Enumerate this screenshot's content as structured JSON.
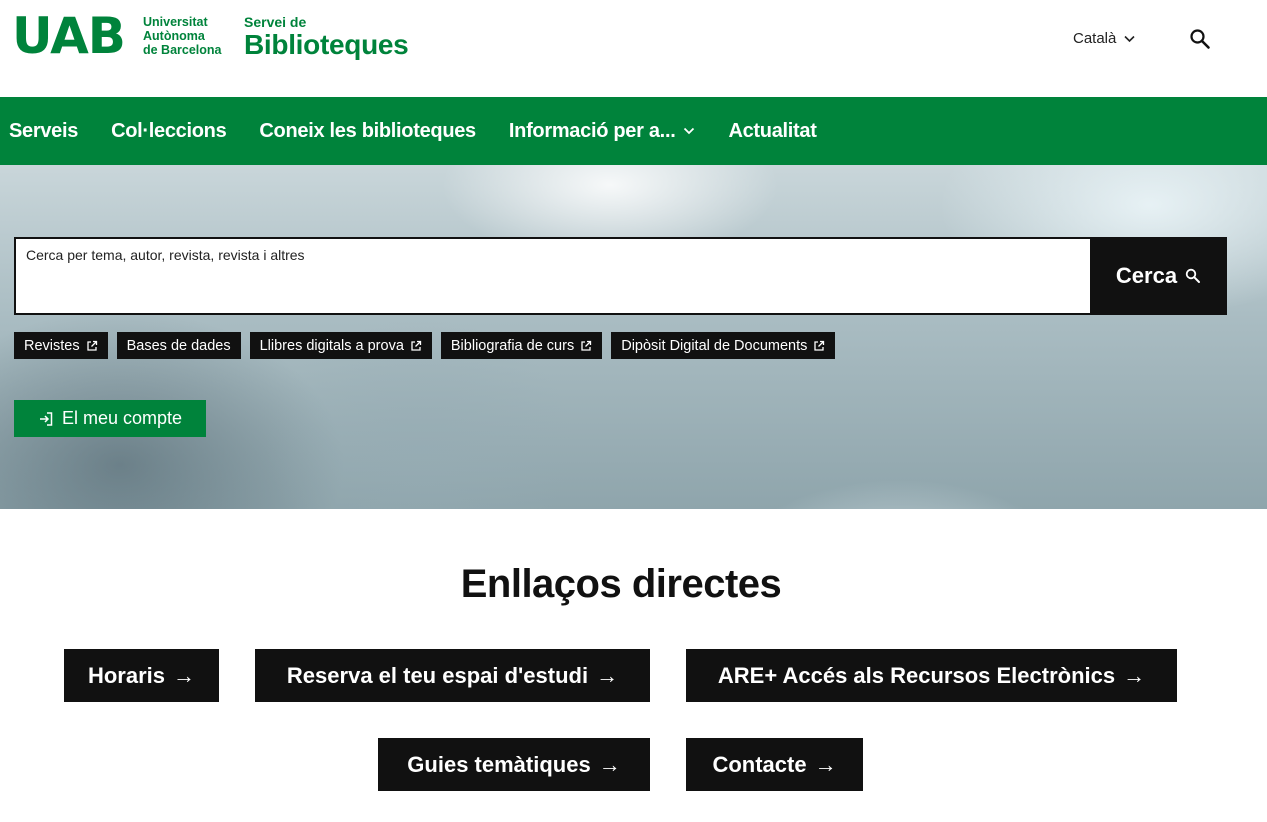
{
  "header": {
    "logo_mark": "UAB",
    "logo_univ_line1": "Universitat",
    "logo_univ_line2": "Autònoma",
    "logo_univ_line3": "de Barcelona",
    "servei_small": "Servei de",
    "servei_big": "Biblioteques",
    "language": "Català",
    "search_icon": "search-icon"
  },
  "nav": {
    "items": [
      {
        "label": "Serveis"
      },
      {
        "label": "Col·leccions"
      },
      {
        "label": "Coneix les biblioteques"
      },
      {
        "label": "Informació per a..."
      },
      {
        "label": "Actualitat"
      }
    ]
  },
  "hero": {
    "search_placeholder": "Cerca per tema, autor, revista, revista i altres",
    "search_button": "Cerca",
    "chips": [
      {
        "label": "Revistes",
        "external": true
      },
      {
        "label": "Bases de dades",
        "external": false
      },
      {
        "label": "Llibres digitals a prova",
        "external": true
      },
      {
        "label": "Bibliografia de curs",
        "external": true
      },
      {
        "label": "Dipòsit Digital de Documents",
        "external": true
      }
    ],
    "account_button": "El meu compte"
  },
  "quick_links": {
    "title": "Enllaços directes",
    "items": [
      {
        "label": "Horaris"
      },
      {
        "label": "Reserva el teu espai d'estudi"
      },
      {
        "label": "ARE+ Accés als Recursos Electrònics"
      },
      {
        "label": "Guies temàtiques"
      },
      {
        "label": "Contacte"
      }
    ]
  },
  "colors": {
    "brand_green": "#00833b",
    "dark": "#111111"
  }
}
